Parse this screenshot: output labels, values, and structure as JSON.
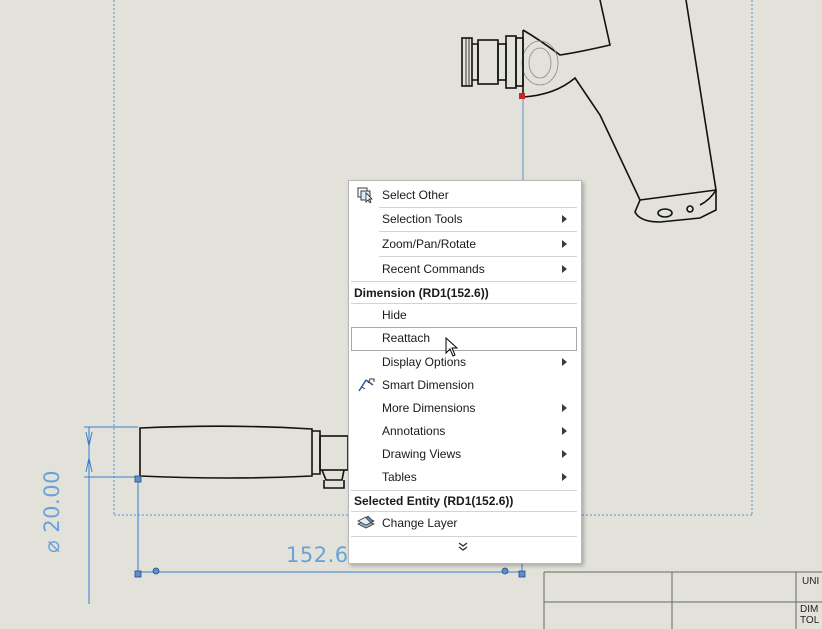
{
  "drawing": {
    "horizontal_dimension": "152.60",
    "vertical_dimension": "⌀ 20.00"
  },
  "context_menu": {
    "items_top": [
      {
        "label": "Select Other",
        "icon": "select-other-icon"
      },
      {
        "label": "Selection Tools",
        "submenu": true
      },
      {
        "label": "Zoom/Pan/Rotate",
        "submenu": true
      },
      {
        "label": "Recent Commands",
        "submenu": true
      }
    ],
    "section_dimension": "Dimension (RD1(152.6))",
    "items_dimension": [
      {
        "label": "Hide"
      },
      {
        "label": "Reattach",
        "highlighted": true
      },
      {
        "label": "Display Options",
        "submenu": true
      },
      {
        "label": "Smart Dimension",
        "icon": "smart-dimension-icon"
      },
      {
        "label": "More Dimensions",
        "submenu": true
      },
      {
        "label": "Annotations",
        "submenu": true
      },
      {
        "label": "Drawing Views",
        "submenu": true
      },
      {
        "label": "Tables",
        "submenu": true
      }
    ],
    "section_entity": "Selected Entity (RD1(152.6))",
    "items_entity": [
      {
        "label": "Change Layer",
        "icon": "change-layer-icon"
      }
    ],
    "expand_icon": "double-chevron-down-icon"
  },
  "title_block": {
    "cell_1": "UNI",
    "cell_2": "DIM",
    "cell_3": "TOL"
  }
}
